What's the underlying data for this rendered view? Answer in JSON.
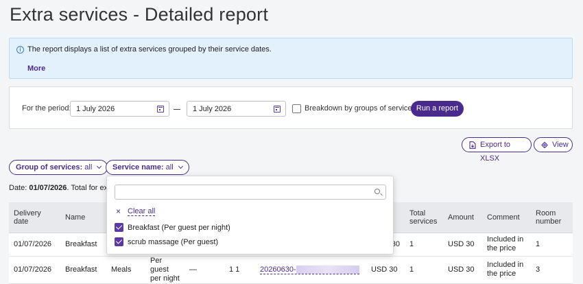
{
  "page": {
    "title": "Extra services - Detailed report"
  },
  "info": {
    "text": "The report displays a list of extra services grouped by their service dates.",
    "more": "More"
  },
  "filters": {
    "period_label": "For the period:",
    "date_from": "1 July 2026",
    "date_to": "1 July 2026",
    "breakdown_label": "Breakdown by groups of services",
    "breakdown_checked": false,
    "run_label": "Run a report"
  },
  "actions": {
    "export_label": "Export to XLSX",
    "view_label": "View"
  },
  "pills": {
    "group": {
      "label": "Group of services:",
      "value": "all"
    },
    "service": {
      "label": "Service name:",
      "value": "all"
    }
  },
  "summary": {
    "prefix": "Date:",
    "date": "01/07/2026",
    "suffix": ". Total for extr"
  },
  "dropdown": {
    "search_value": "",
    "clear_all": "Clear all",
    "options": [
      {
        "label": "Breakfast (Per guest per night)",
        "checked": true
      },
      {
        "label": "scrub massage (Per guest)",
        "checked": true
      }
    ]
  },
  "table": {
    "headers": {
      "delivery_date": "Delivery date",
      "name": "Name",
      "total_services": "Total services",
      "amount": "Amount",
      "comment": "Comment",
      "room_number": "Room number"
    },
    "rows": [
      {
        "delivery_date": "01/07/2026",
        "name": "Breakfast",
        "amount_partial": "30",
        "total": "1",
        "amount": "USD 30",
        "comment": "Included in the price",
        "room": "1"
      },
      {
        "delivery_date": "01/07/2026",
        "name": "Breakfast",
        "group": "Meals",
        "unit": "Per guest per night",
        "dash": "—",
        "qty": "1 1",
        "booking": "20260630-",
        "amount_partial": "USD 30",
        "total": "1",
        "amount": "USD 30",
        "comment": "Included in the price",
        "room": "3"
      }
    ]
  },
  "colors": {
    "accent": "#4b2a8c",
    "info_bg": "#e3f1fc"
  }
}
